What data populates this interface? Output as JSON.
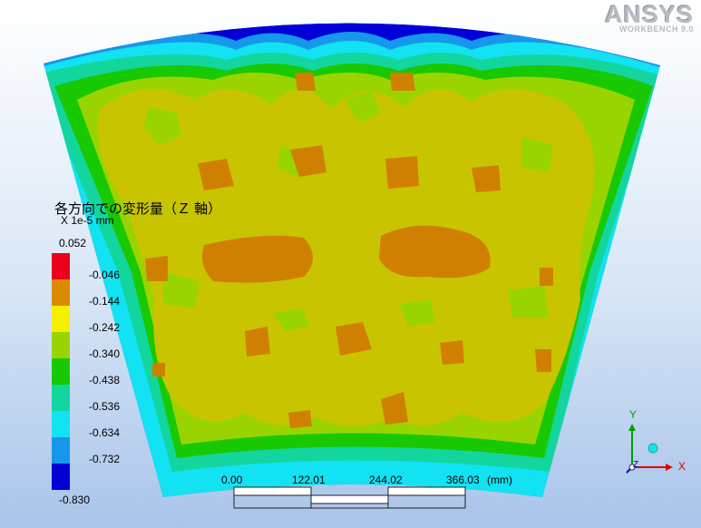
{
  "logo": {
    "brand": "ANSYS",
    "product": "WORKBENCH 9.0"
  },
  "legend": {
    "title": "各方向での変形量（Ｚ 軸）",
    "unit_line": "X 1e-5 mm",
    "max": "0.052",
    "min": "-0.830",
    "levels": [
      "-0.046",
      "-0.144",
      "-0.242",
      "-0.340",
      "-0.438",
      "-0.536",
      "-0.634",
      "-0.732"
    ],
    "colors": [
      "#e8001c",
      "#d98a00",
      "#f3f000",
      "#9ad400",
      "#18c800",
      "#13d69e",
      "#12e2f2",
      "#1597ec",
      "#0000d6"
    ]
  },
  "scale_bar": {
    "ticks": [
      "0.00",
      "122.01",
      "244.02",
      "366.03"
    ],
    "unit": "(mm)"
  },
  "triad": {
    "y": "Y",
    "x": "X",
    "z": "Z"
  },
  "contour_colors": {
    "dark_blue": "#0000d6",
    "light_blue": "#1597ec",
    "cyan": "#12e2f2",
    "teal": "#13d69e",
    "green": "#18c800",
    "yellow_green": "#9ad400",
    "olive": "#c8c400",
    "orange": "#d08000"
  }
}
